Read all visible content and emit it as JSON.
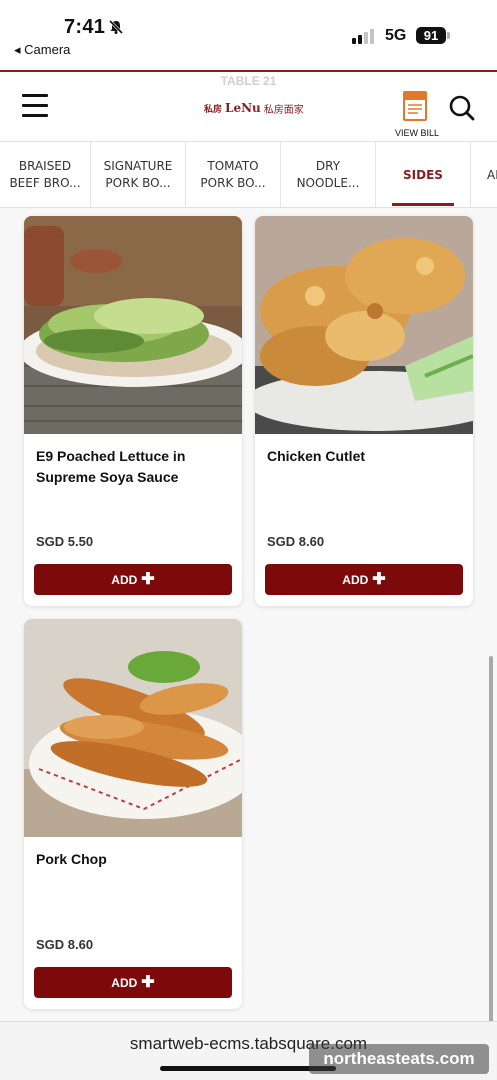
{
  "status_bar": {
    "time": "7:41",
    "back_label": "◂ Camera",
    "network": "5G",
    "battery": "91"
  },
  "header": {
    "table_label": "TABLE 21",
    "logo_mark": "私房",
    "logo_name": "LeNu",
    "logo_cn": "私房面家",
    "bill_label": "VIEW BILL"
  },
  "tabs": [
    {
      "line1": "BRAISED",
      "line2": "BEEF BRO..."
    },
    {
      "line1": "SIGNATURE",
      "line2": "PORK BO..."
    },
    {
      "line1": "TOMATO",
      "line2": "PORK BO..."
    },
    {
      "line1": "DRY",
      "line2": "NOODLE..."
    },
    {
      "line1": "SIDES",
      "line2": ""
    },
    {
      "line1": "AP",
      "line2": ""
    }
  ],
  "active_tab": "SIDES",
  "items": [
    {
      "name": "E9 Poached Lettuce in Supreme Soya Sauce",
      "price": "SGD 5.50",
      "add_label": "ADD"
    },
    {
      "name": "Chicken Cutlet",
      "price": "SGD 8.60",
      "add_label": "ADD"
    },
    {
      "name": "Pork Chop",
      "price": "SGD 8.60",
      "add_label": "ADD"
    }
  ],
  "url": "smartweb-ecms.tabsquare.com",
  "watermark": "northeasteats.com",
  "colors": {
    "brand": "#7c0a0a",
    "accent": "#8a1c1c",
    "bill_icon": "#e07a2a"
  }
}
